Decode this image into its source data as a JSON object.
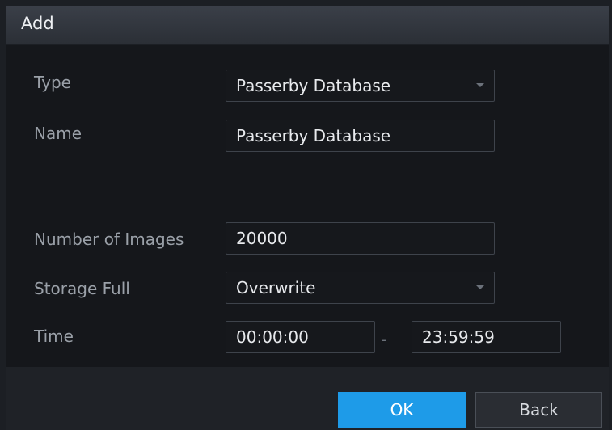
{
  "dialog": {
    "title": "Add"
  },
  "form": {
    "type": {
      "label": "Type",
      "value": "Passerby Database"
    },
    "name": {
      "label": "Name",
      "value": "Passerby Database"
    },
    "number_of_images": {
      "label": "Number of Images",
      "value": "20000"
    },
    "storage_full": {
      "label": "Storage Full",
      "value": "Overwrite"
    },
    "time": {
      "label": "Time",
      "start": "00:00:00",
      "separator": "-",
      "end": "23:59:59"
    }
  },
  "buttons": {
    "ok": "OK",
    "back": "Back"
  },
  "colors": {
    "accent": "#1e9be8",
    "background": "#15171b",
    "titlebar": "#33373f"
  }
}
